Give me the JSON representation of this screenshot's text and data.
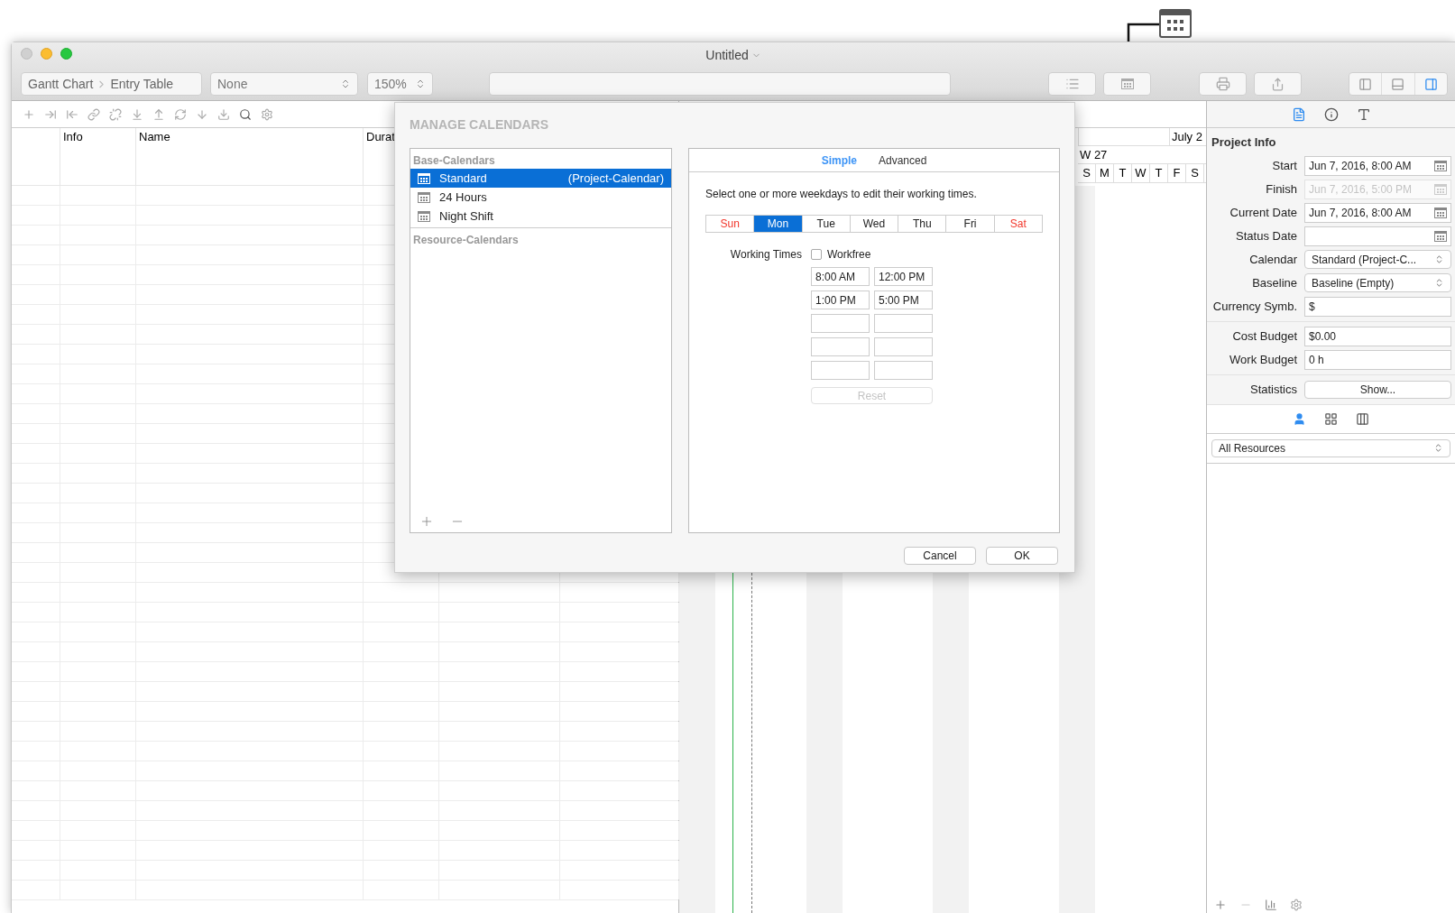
{
  "window": {
    "title": "Untitled"
  },
  "toolbar": {
    "breadcrumb": [
      "Gantt Chart",
      "Entry Table"
    ],
    "filter": "None",
    "zoom": "150%"
  },
  "table": {
    "columns": [
      "Info",
      "Name",
      "Durat"
    ]
  },
  "gantt": {
    "month": "July 2",
    "week": "W 27",
    "days": [
      "S",
      "M",
      "T",
      "W",
      "T",
      "F",
      "S"
    ]
  },
  "dialog": {
    "title": "MANAGE CALENDARS",
    "base_heading": "Base-Calendars",
    "base_calendars": [
      {
        "name": "Standard",
        "note": "(Project-Calendar)",
        "selected": true
      },
      {
        "name": "24 Hours",
        "selected": false
      },
      {
        "name": "Night Shift",
        "selected": false
      }
    ],
    "resource_heading": "Resource-Calendars",
    "tabs": [
      {
        "label": "Simple",
        "selected": true
      },
      {
        "label": "Advanced",
        "selected": false
      }
    ],
    "instruction": "Select one or more weekdays to edit their working times.",
    "weekdays": [
      {
        "label": "Sun",
        "weekend": true,
        "selected": false
      },
      {
        "label": "Mon",
        "weekend": false,
        "selected": true
      },
      {
        "label": "Tue",
        "weekend": false,
        "selected": false
      },
      {
        "label": "Wed",
        "weekend": false,
        "selected": false
      },
      {
        "label": "Thu",
        "weekend": false,
        "selected": false
      },
      {
        "label": "Fri",
        "weekend": false,
        "selected": false
      },
      {
        "label": "Sat",
        "weekend": true,
        "selected": false
      }
    ],
    "working_times_label": "Working Times",
    "workfree": {
      "label": "Workfree",
      "checked": false
    },
    "times": [
      {
        "start": "8:00 AM",
        "end": "12:00 PM"
      },
      {
        "start": "1:00 PM",
        "end": "5:00 PM"
      }
    ],
    "reset": {
      "label": "Reset",
      "disabled": true
    },
    "buttons": [
      "Cancel",
      "OK"
    ]
  },
  "inspector": {
    "tabs": [
      {
        "kind": "document",
        "selected": true
      },
      {
        "kind": "info",
        "selected": false
      },
      {
        "kind": "format",
        "selected": false
      }
    ],
    "title": "Project Info",
    "groups": [
      [
        {
          "label": "Start",
          "kind": "date",
          "value": "Jun 7, 2016, 8:00 AM",
          "disabled": false
        },
        {
          "label": "Finish",
          "kind": "date",
          "value": "Jun 7, 2016, 5:00 PM",
          "disabled": true
        },
        {
          "label": "Current Date",
          "kind": "date",
          "value": "Jun 7, 2016, 8:00 AM",
          "disabled": false
        },
        {
          "label": "Status Date",
          "kind": "date",
          "disabled": false
        },
        {
          "label": "Calendar",
          "kind": "select",
          "value": "Standard (Project-C..."
        },
        {
          "label": "Baseline",
          "kind": "select",
          "value": "Baseline (Empty)"
        },
        {
          "label": "Currency Symb.",
          "kind": "text",
          "value": "$"
        }
      ],
      [
        {
          "label": "Cost Budget",
          "kind": "text",
          "value": "$0.00"
        },
        {
          "label": "Work Budget",
          "kind": "text",
          "value": "0 h"
        }
      ],
      [
        {
          "label": "Statistics",
          "kind": "button",
          "value": "Show..."
        }
      ]
    ],
    "views": [
      {
        "kind": "resources",
        "selected": true
      },
      {
        "kind": "assignments",
        "selected": false
      },
      {
        "kind": "columns",
        "selected": false
      }
    ],
    "filter": "All Resources"
  }
}
